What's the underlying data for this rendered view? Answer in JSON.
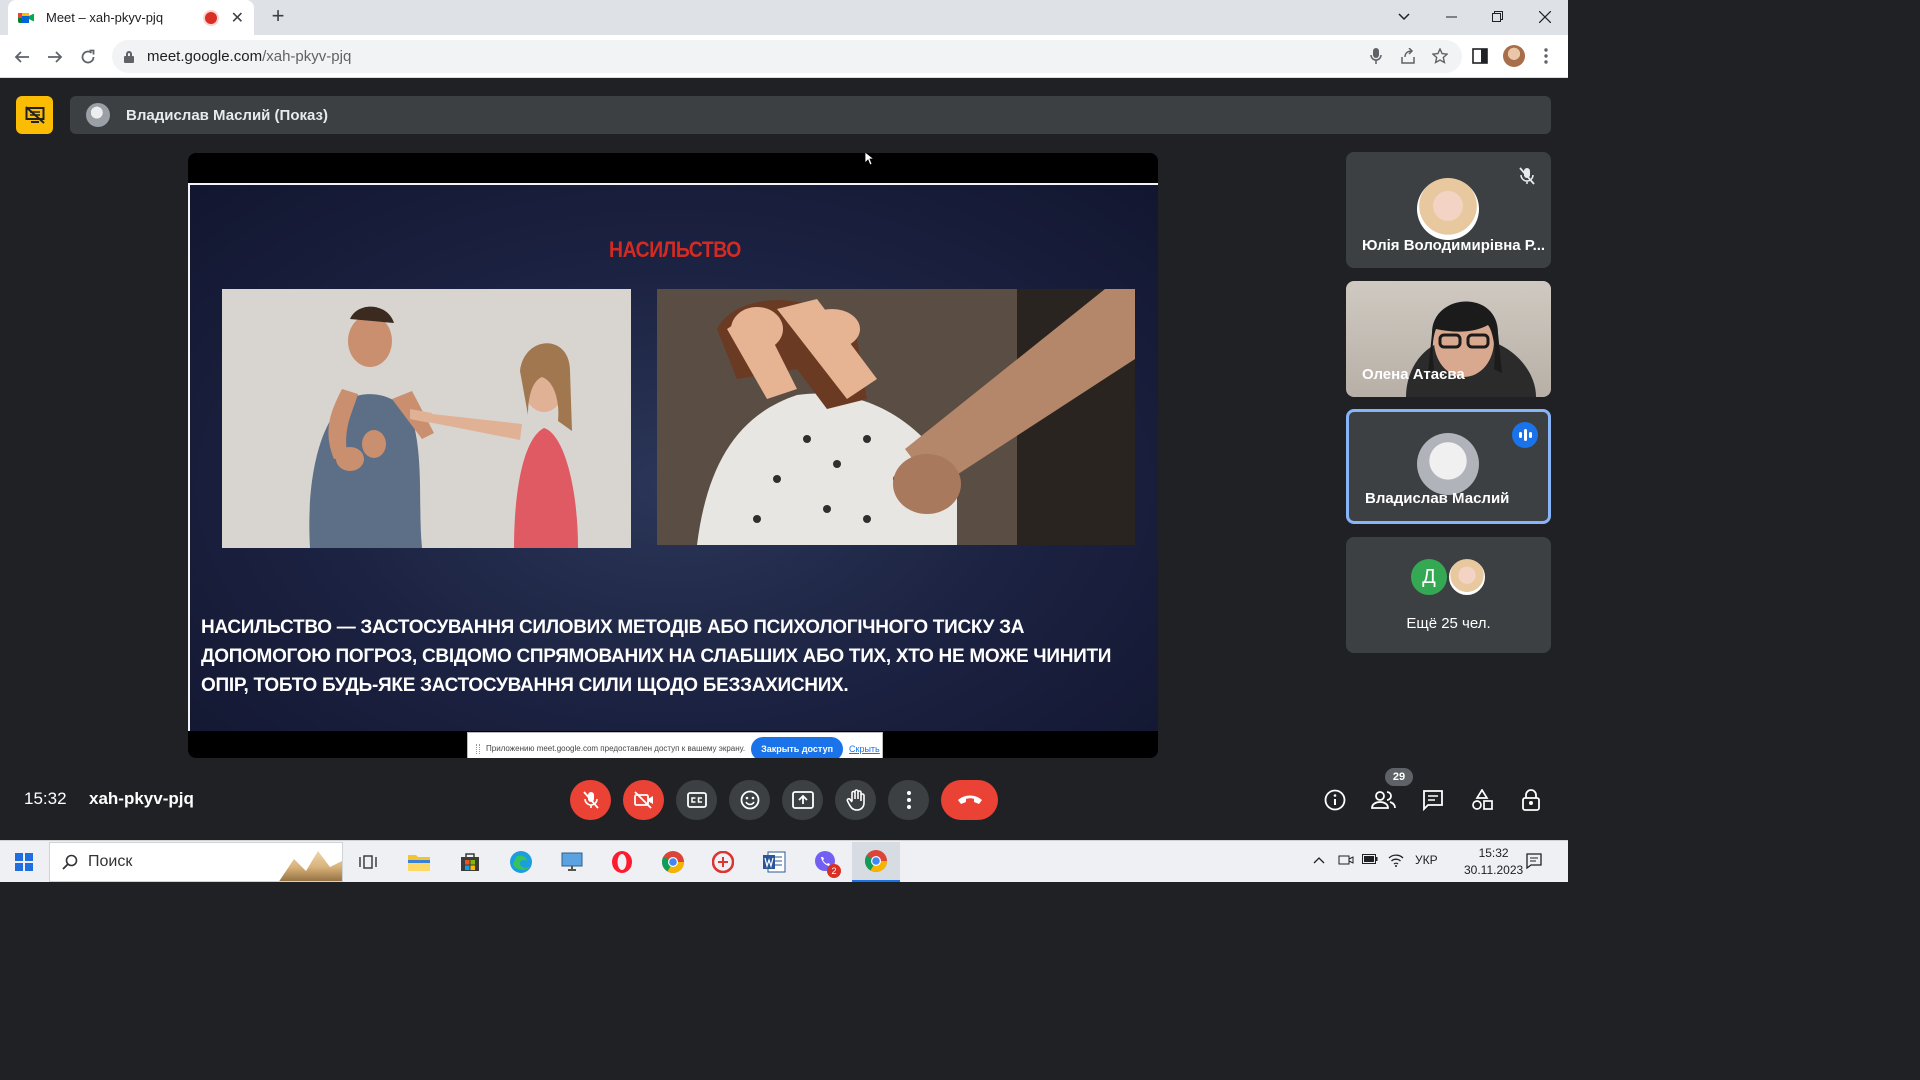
{
  "browser": {
    "tab_title": "Meet – xah-pkyv-pjq",
    "tab_close": "✕",
    "new_tab": "+",
    "url_host": "meet.google.com",
    "url_path": "/xah-pkyv-pjq"
  },
  "meet": {
    "presenter_label": "Владислав Маслий (Показ)",
    "slide": {
      "title": "НАСИЛЬСТВО",
      "body": "НАСИЛЬСТВО — ЗАСТОСУВАННЯ СИЛОВИХ МЕТОДІВ АБО ПСИХОЛОГІЧНОГО ТИСКУ ЗА ДОПОМОГОЮ ПОГРОЗ, СВІДОМО СПРЯМОВАНИХ НА СЛАБШИХ АБО ТИХ, ХТО НЕ МОЖЕ ЧИНИТИ ОПІР, ТОБТО БУДЬ-ЯКЕ ЗАСТОСУВАННЯ СИЛИ ЩОДО БЕЗЗАХИСНИХ."
    },
    "share_notice": {
      "text": "Приложению meet.google.com предоставлен доступ к вашему экрану.",
      "stop_label": "Закрыть доступ",
      "hide_label": "Скрыть"
    },
    "participants": [
      {
        "name": "Юлія Володимирівна Р...",
        "muted": true
      },
      {
        "name": "Олена Атаєва"
      },
      {
        "name": "Владислав Маслий",
        "speaking": true
      }
    ],
    "more": {
      "avatar_letter": "Д",
      "label": "Ещё 25 чел."
    },
    "time": "15:32",
    "meeting_code": "xah-pkyv-pjq",
    "people_count": "29",
    "colors": {
      "accent": "#1a73e8",
      "danger": "#ea4335",
      "present": "#fbbc04"
    }
  },
  "taskbar": {
    "search_label": "Поиск",
    "language": "УКР",
    "time": "15:32",
    "date": "30.11.2023",
    "viber_badge": "2"
  }
}
